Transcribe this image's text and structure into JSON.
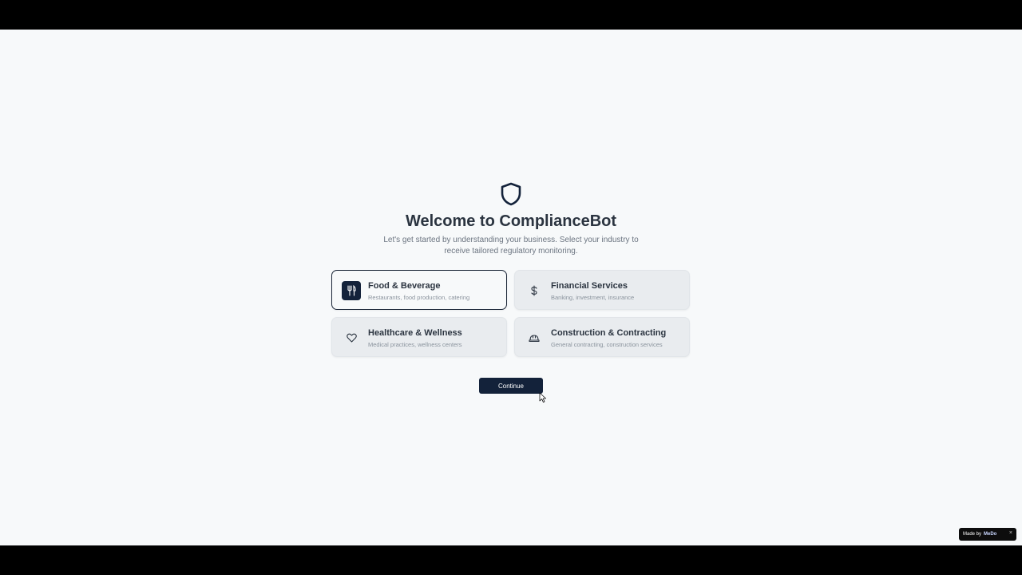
{
  "app": {
    "title": "Welcome to ComplianceBot",
    "subtitle_line1": "Let's get started by understanding your business. Select your industry to",
    "subtitle_line2": "receive tailored regulatory monitoring.",
    "logo_icon": "shield-icon"
  },
  "industries": [
    {
      "label": "Food & Beverage",
      "description": "Restaurants, food production, catering",
      "icon": "utensils-icon",
      "selected": true
    },
    {
      "label": "Financial Services",
      "description": "Banking, investment, insurance",
      "icon": "dollar-icon",
      "selected": false
    },
    {
      "label": "Healthcare & Wellness",
      "description": "Medical practices, wellness centers",
      "icon": "heart-icon",
      "selected": false
    },
    {
      "label": "Construction & Contracting",
      "description": "General contracting, construction services",
      "icon": "hard-hat-icon",
      "selected": false
    }
  ],
  "actions": {
    "continue_label": "Continue"
  },
  "badge": {
    "made_by": "Made by",
    "brand": "MeDo",
    "close": "×"
  },
  "colors": {
    "primary": "#13223a",
    "background": "#f7f9fa",
    "card": "#e9ecef",
    "text": "#2b3440",
    "muted": "#6b7480"
  }
}
